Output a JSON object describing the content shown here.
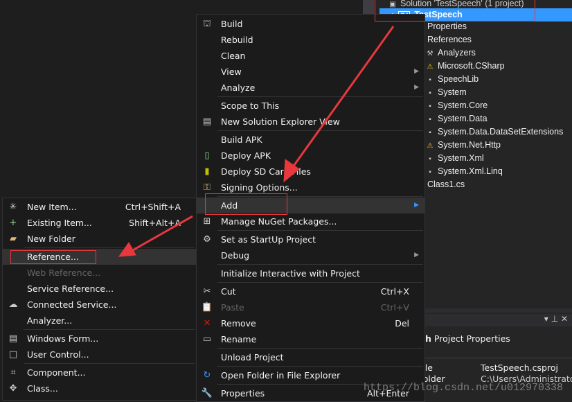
{
  "solution_explorer": {
    "solution_label": "Solution 'TestSpeech' (1 project)",
    "project": "TestSpeech",
    "items": [
      {
        "label": "Properties",
        "icon": "wrench-icon"
      },
      {
        "label": "References",
        "icon": "references-icon"
      },
      {
        "label": "Analyzers",
        "icon": "analyzer-icon"
      },
      {
        "label": "Microsoft.CSharp",
        "icon": "warning-reference-icon"
      },
      {
        "label": "SpeechLib",
        "icon": "reference-icon"
      },
      {
        "label": "System",
        "icon": "reference-icon"
      },
      {
        "label": "System.Core",
        "icon": "reference-icon"
      },
      {
        "label": "System.Data",
        "icon": "reference-icon"
      },
      {
        "label": "System.Data.DataSetExtensions",
        "icon": "reference-icon"
      },
      {
        "label": "System.Net.Http",
        "icon": "warning-reference-icon"
      },
      {
        "label": "System.Xml",
        "icon": "reference-icon"
      },
      {
        "label": "System.Xml.Linq",
        "icon": "reference-icon"
      },
      {
        "label": "Class1.cs",
        "icon": "csharp-file-icon"
      }
    ]
  },
  "properties_panel": {
    "title_suffix": "h",
    "title": "Project Properties",
    "rows": [
      {
        "name": "File",
        "value": "TestSpeech.csproj"
      },
      {
        "name": "Folder",
        "value": "C:\\Users\\Administrator"
      }
    ]
  },
  "context_menu": {
    "items": [
      {
        "label": "Build",
        "icon": "build-icon"
      },
      {
        "label": "Rebuild"
      },
      {
        "label": "Clean"
      },
      {
        "label": "View",
        "submenu": true
      },
      {
        "label": "Analyze",
        "submenu": true
      },
      {
        "separator": true
      },
      {
        "label": "Scope to This"
      },
      {
        "label": "New Solution Explorer View",
        "icon": "new-view-icon"
      },
      {
        "separator": true
      },
      {
        "label": "Build APK"
      },
      {
        "label": "Deploy APK",
        "icon": "deploy-apk-icon"
      },
      {
        "label": "Deploy SD Card Files",
        "icon": "sd-card-icon"
      },
      {
        "label": "Signing Options...",
        "icon": "key-icon"
      },
      {
        "separator": true
      },
      {
        "label": "Add",
        "submenu": true,
        "highlighted": true
      },
      {
        "label": "Manage NuGet Packages...",
        "icon": "nuget-icon"
      },
      {
        "separator": true
      },
      {
        "label": "Set as StartUp Project",
        "icon": "gear-icon"
      },
      {
        "label": "Debug",
        "submenu": true
      },
      {
        "separator": true
      },
      {
        "label": "Initialize Interactive with Project"
      },
      {
        "separator": true
      },
      {
        "label": "Cut",
        "icon": "scissors-icon",
        "shortcut": "Ctrl+X"
      },
      {
        "label": "Paste",
        "icon": "paste-icon",
        "shortcut": "Ctrl+V",
        "disabled": true
      },
      {
        "label": "Remove",
        "icon": "remove-icon",
        "shortcut": "Del"
      },
      {
        "label": "Rename",
        "icon": "rename-icon"
      },
      {
        "separator": true
      },
      {
        "label": "Unload Project"
      },
      {
        "separator": true
      },
      {
        "label": "Open Folder in File Explorer",
        "icon": "refresh-icon"
      },
      {
        "separator": true
      },
      {
        "label": "Properties",
        "icon": "wrench-icon",
        "shortcut": "Alt+Enter"
      }
    ]
  },
  "add_submenu": {
    "items": [
      {
        "label": "New Item...",
        "icon": "new-item-icon",
        "shortcut": "Ctrl+Shift+A"
      },
      {
        "label": "Existing Item...",
        "icon": "existing-item-icon",
        "shortcut": "Shift+Alt+A"
      },
      {
        "label": "New Folder",
        "icon": "new-folder-icon"
      },
      {
        "separator": true
      },
      {
        "label": "Reference...",
        "highlighted": true
      },
      {
        "label": "Web Reference...",
        "disabled": true
      },
      {
        "label": "Service Reference..."
      },
      {
        "label": "Connected Service...",
        "icon": "connected-service-icon"
      },
      {
        "label": "Analyzer..."
      },
      {
        "separator": true
      },
      {
        "label": "Windows Form...",
        "icon": "windows-form-icon"
      },
      {
        "label": "User Control...",
        "icon": "user-control-icon"
      },
      {
        "separator": true
      },
      {
        "label": "Component...",
        "icon": "component-icon"
      },
      {
        "label": "Class...",
        "icon": "class-icon"
      }
    ]
  },
  "watermark": "https://blog.csdn.net/u012970338",
  "colors": {
    "selection": "#3399ff",
    "annotation": "#e8383d",
    "menu_bg": "#1b1b1c"
  }
}
